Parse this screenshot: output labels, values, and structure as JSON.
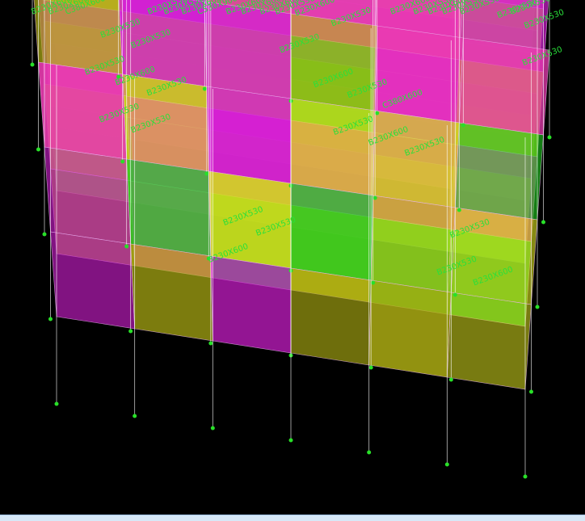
{
  "colors": {
    "background": "#000000",
    "slab_yellow": "#b5b514",
    "slab_bright_yellow": "#d6dc1e",
    "slab_magenta": "#d51fd5",
    "slab_pink": "#ea3bb1",
    "slab_green": "#22d422",
    "beam_lines": "#e7b3ec",
    "column_lines": "#ffffff",
    "support": "#28e028",
    "label_text": "#29e03a",
    "statusbar": "#d7e8f7"
  },
  "viewport": {
    "view": "3D",
    "labels": [
      {
        "text": "B230X600"
      },
      {
        "text": "B230X600"
      },
      {
        "text": "B230X530"
      },
      {
        "text": "B230X530"
      },
      {
        "text": "B230X530"
      },
      {
        "text": "B230X530"
      },
      {
        "text": "B230X530"
      },
      {
        "text": "B230X530"
      },
      {
        "text": "B230X530"
      },
      {
        "text": "B230X600"
      },
      {
        "text": "B230X600"
      },
      {
        "text": "B230X530"
      },
      {
        "text": "B230X600"
      },
      {
        "text": "B230X530"
      },
      {
        "text": "B230X530"
      },
      {
        "text": "B230X600"
      },
      {
        "text": "B230X530"
      },
      {
        "text": "B230X600"
      },
      {
        "text": "B230X600"
      },
      {
        "text": "B230X600"
      },
      {
        "text": "B230X600"
      },
      {
        "text": "B230X600"
      },
      {
        "text": "B230X600"
      },
      {
        "text": "B230X600"
      },
      {
        "text": "B230X600"
      },
      {
        "text": "B230X530"
      },
      {
        "text": "B230X530"
      },
      {
        "text": "B230X530"
      },
      {
        "text": "B230X530"
      },
      {
        "text": "B230X530"
      },
      {
        "text": "B230X530"
      },
      {
        "text": "B230X530"
      },
      {
        "text": "B230X530"
      },
      {
        "text": "B230X530"
      },
      {
        "text": "B230X530"
      },
      {
        "text": "B230X530"
      },
      {
        "text": "C530X900"
      },
      {
        "text": "C380X600"
      },
      {
        "text": "C380X600"
      },
      {
        "text": "B230X530"
      },
      {
        "text": "B230X530"
      },
      {
        "text": "B230X530"
      }
    ]
  }
}
